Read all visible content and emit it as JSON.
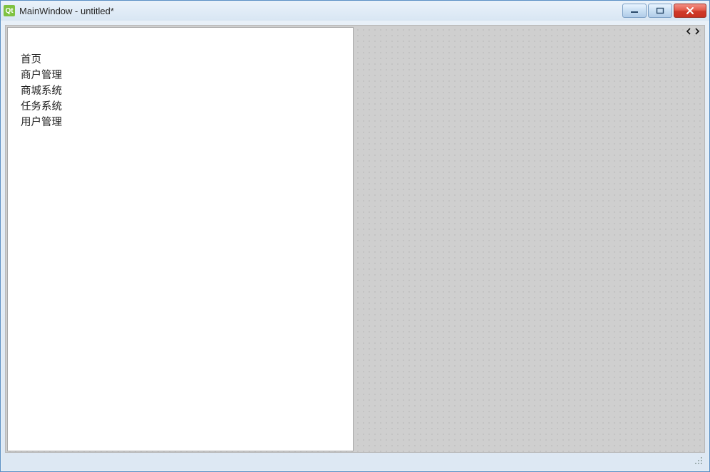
{
  "window": {
    "app_icon_text": "Qt",
    "title": "MainWindow - untitled*"
  },
  "tree": {
    "items": [
      {
        "label": "首页"
      },
      {
        "label": "商户管理"
      },
      {
        "label": "商城系统"
      },
      {
        "label": "任务系统"
      },
      {
        "label": "用户管理"
      }
    ]
  }
}
